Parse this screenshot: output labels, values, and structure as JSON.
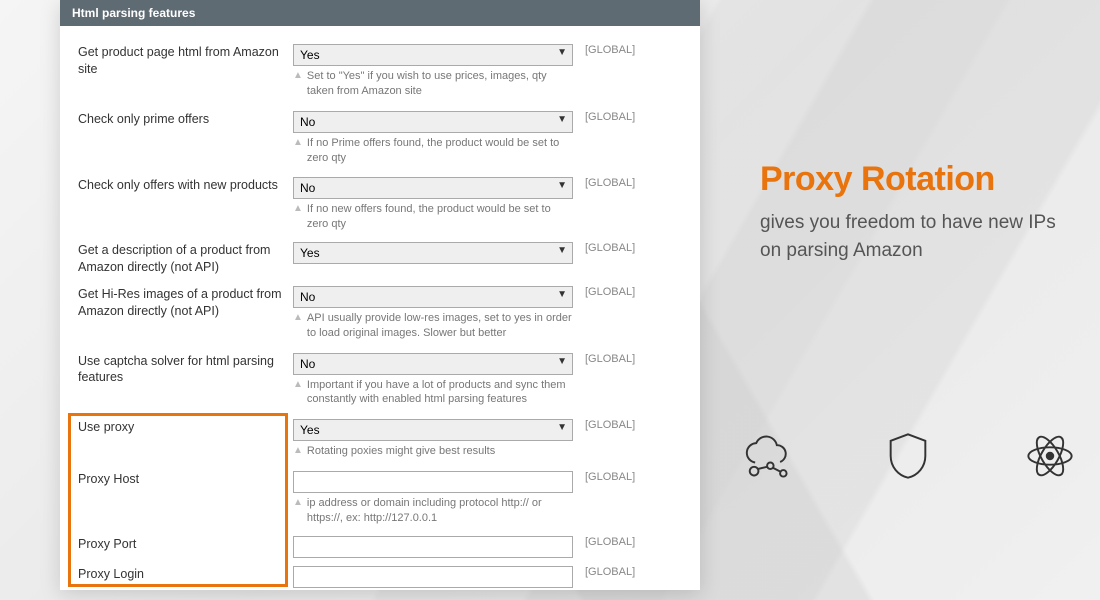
{
  "panel": {
    "header": "Html parsing features"
  },
  "fields": [
    {
      "label": "Get product page html from Amazon site",
      "type": "select",
      "value": "Yes",
      "hint": "Set to \"Yes\" if you wish to use prices, images, qty taken from Amazon site"
    },
    {
      "label": "Check only prime offers",
      "type": "select",
      "value": "No",
      "hint": "If no Prime offers found, the product would be set to zero qty"
    },
    {
      "label": "Check only offers with new products",
      "type": "select",
      "value": "No",
      "hint": "If no new offers found, the product would be set to zero qty"
    },
    {
      "label": "Get a description of a product from Amazon directly (not API)",
      "type": "select",
      "value": "Yes",
      "hint": ""
    },
    {
      "label": "Get Hi-Res images of a product from Amazon directly (not API)",
      "type": "select",
      "value": "No",
      "hint": "API usually provide low-res images, set to yes in order to load original images. Slower but better"
    },
    {
      "label": "Use captcha solver for html parsing features",
      "type": "select",
      "value": "No",
      "hint": "Important if you have a lot of products and sync them constantly with enabled html parsing features"
    },
    {
      "label": "Use proxy",
      "type": "select",
      "value": "Yes",
      "hint": "Rotating poxies might give best results"
    },
    {
      "label": "Proxy Host",
      "type": "text",
      "value": "",
      "hint": "ip address or domain including protocol http:// or https://, ex: http://127.0.0.1"
    },
    {
      "label": "Proxy Port",
      "type": "text",
      "value": "",
      "hint": ""
    },
    {
      "label": "Proxy Login",
      "type": "text",
      "value": "",
      "hint": ""
    }
  ],
  "scope_label": "[GLOBAL]",
  "promo": {
    "title": "Proxy Rotation",
    "subtitle": "gives you freedom to have new IPs on parsing Amazon"
  }
}
